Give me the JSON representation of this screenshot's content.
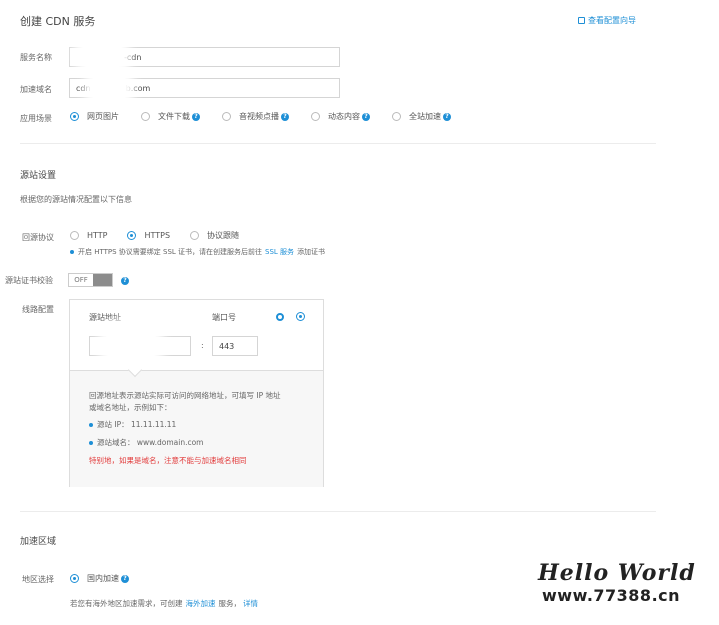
{
  "page": {
    "title": "创建 CDN 服务",
    "guide_link": "查看配置向导"
  },
  "service": {
    "name_label": "服务名称",
    "name_value": "-cdn",
    "domain_label": "加速域名",
    "domain_value_prefix": "cdn",
    "domain_value_suffix": "gb.com",
    "scene_label": "应用场景",
    "scenes": [
      {
        "label": "网页图片",
        "selected": true
      },
      {
        "label": "文件下载",
        "selected": false
      },
      {
        "label": "音视频点播",
        "selected": false
      },
      {
        "label": "动态内容",
        "selected": false
      },
      {
        "label": "全站加速",
        "selected": false
      }
    ]
  },
  "origin": {
    "section_title": "源站设置",
    "hint": "根据您的源站情况配置以下信息",
    "protocol_label": "回源协议",
    "protocols": [
      {
        "label": "HTTP",
        "selected": false
      },
      {
        "label": "HTTPS",
        "selected": true
      },
      {
        "label": "协议跟随",
        "selected": false
      }
    ],
    "https_note_pre": "开启 HTTPS 协议需要绑定 SSL 证书，请在创建服务后前往",
    "https_note_link": "SSL 服务",
    "https_note_post": "添加证书",
    "cert_label": "源站证书校验",
    "cert_toggle": "OFF",
    "line_label": "线路配置",
    "addr_header": "源站地址",
    "port_header": "端口号",
    "port_sep": ":",
    "port_value": "443",
    "tip_line1": "回源地址表示源站实际可访问的网络地址，可填写 IP 地址",
    "tip_line2": "或域名地址，示例如下：",
    "tip_ip": "源站 IP： 11.11.11.11",
    "tip_domain": "源站域名： www.domain.com",
    "tip_warning": "特别地，如果是域名，注意不能与加速域名相同"
  },
  "region": {
    "section_title": "加速区域",
    "region_label": "地区选择",
    "region_option": "国内加速",
    "note_pre": "若您有海外地区加速需求，可创建",
    "note_link1": "海外加速",
    "note_mid": "服务，",
    "note_link2": "详情"
  },
  "watermark": {
    "line1": "Hello World",
    "line2": "www.77388.cn"
  },
  "colors": {
    "accent": "#1e8fd6",
    "warning": "#e23b3b",
    "border": "#d5d5d5"
  }
}
